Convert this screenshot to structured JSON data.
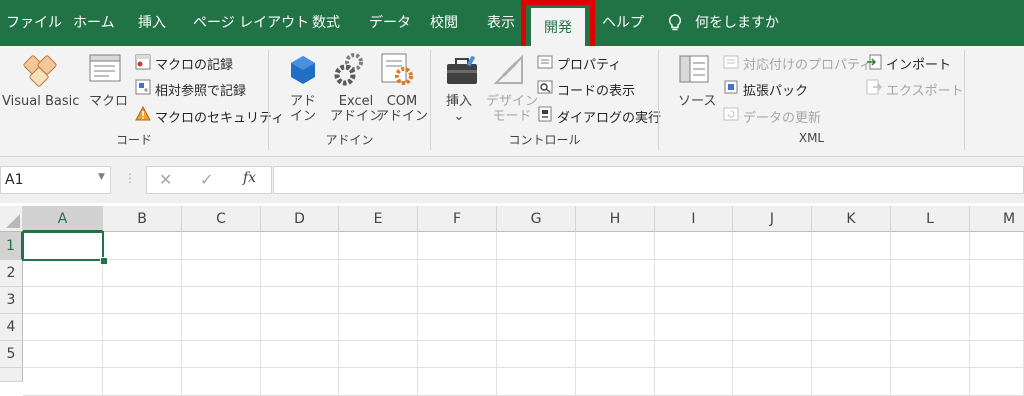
{
  "tabs": [
    "ファイル",
    "ホーム",
    "挿入",
    "ページ レイアウト",
    "数式",
    "データ",
    "校閲",
    "表示",
    "開発",
    "ヘルプ"
  ],
  "active_tab": "開発",
  "tell_me": "何をしますか",
  "ribbon": {
    "code": {
      "visual_basic": "Visual Basic",
      "macro": "マクロ",
      "record_macro": "マクロの記録",
      "relative_ref": "相対参照で記録",
      "macro_security": "マクロのセキュリティ",
      "group_label": "コード"
    },
    "addins": {
      "addin_line1": "アド",
      "addin_line2": "イン",
      "excel_line1": "Excel",
      "excel_line2": "アドイン",
      "com_line1": "COM",
      "com_line2": "アドイン",
      "group_label": "アドイン"
    },
    "controls": {
      "insert": "挿入",
      "design_line1": "デザイン",
      "design_line2": "モード",
      "properties": "プロパティ",
      "view_code": "コードの表示",
      "run_dialog": "ダイアログの実行",
      "group_label": "コントロール"
    },
    "xml": {
      "source": "ソース",
      "map_properties": "対応付けのプロパティ",
      "expansion_packs": "拡張パック",
      "refresh_data": "データの更新",
      "import": "インポート",
      "export": "エクスポート",
      "group_label": "XML"
    }
  },
  "formula_bar": {
    "name_box": "A1",
    "fx": "fx",
    "formula": ""
  },
  "sheet": {
    "columns": [
      "A",
      "B",
      "C",
      "D",
      "E",
      "F",
      "G",
      "H",
      "I",
      "J",
      "K",
      "L",
      "M"
    ],
    "rows": [
      "1",
      "2",
      "3",
      "4",
      "5"
    ],
    "selected_cell": "A1"
  },
  "colors": {
    "brand": "#217346",
    "highlight": "#e00000",
    "ribbon_bg": "#f3f3f3"
  }
}
